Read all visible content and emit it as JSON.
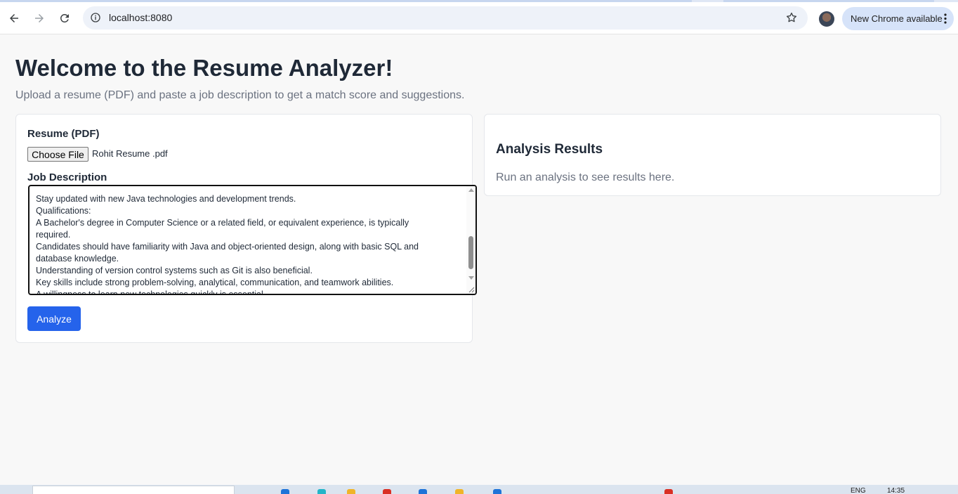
{
  "browser": {
    "url": "localhost:8080",
    "update_label": "New Chrome available",
    "icons": {
      "back": "arrow-left-icon",
      "forward": "arrow-right-icon",
      "reload": "reload-icon",
      "site_info": "info-icon",
      "bookmark": "star-icon",
      "menu": "kebab-menu-icon"
    }
  },
  "page": {
    "title": "Welcome to the Resume Analyzer!",
    "subtitle": "Upload a resume (PDF) and paste a job description to get a match score and suggestions."
  },
  "form": {
    "resume_label": "Resume (PDF)",
    "choose_file_label": "Choose File",
    "file_name": "Rohit Resume .pdf",
    "job_description_label": "Job Description",
    "job_description_lines": [
      "Stay updated with new Java technologies and development trends.",
      "Qualifications:",
      "A Bachelor's degree in Computer Science or a related field, or equivalent experience, is typically",
      "required.",
      "Candidates should have familiarity with Java and object-oriented design, along with basic SQL and",
      "database knowledge.",
      "Understanding of version control systems such as Git is also beneficial.",
      "Key skills include strong problem-solving, analytical, communication, and teamwork abilities.",
      "A willingness to learn new technologies quickly is essential."
    ],
    "analyze_label": "Analyze"
  },
  "results": {
    "title": "Analysis Results",
    "placeholder": "Run an analysis to see results here."
  },
  "taskbar": {
    "language": "ENG",
    "time": "14:35"
  },
  "colors": {
    "accent": "#2563eb",
    "page_background": "#f8f8f8",
    "update_pill": "#d6e3f9"
  }
}
